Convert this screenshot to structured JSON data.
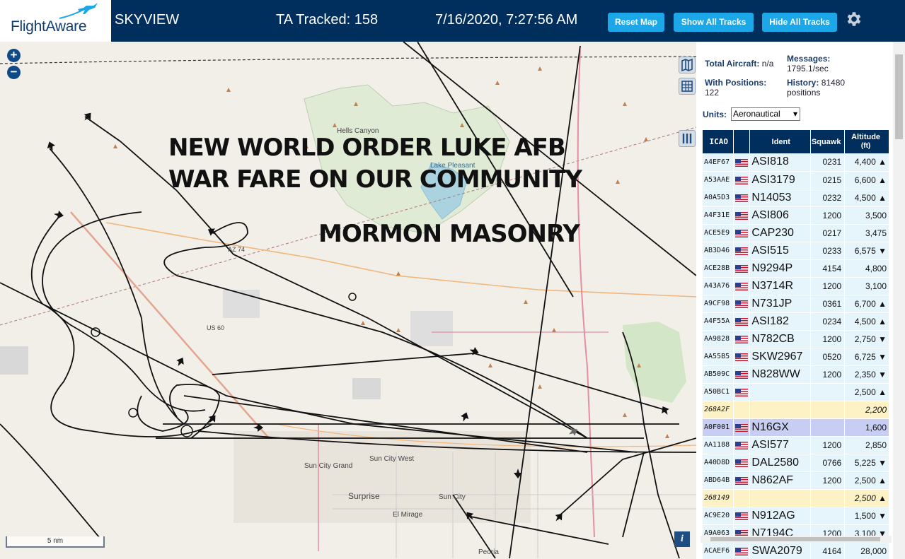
{
  "header": {
    "logo": "FlightAware",
    "app_name": "SKYVIEW",
    "tracked": "TA Tracked: 158",
    "datetime": "7/16/2020, 7:27:56 AM",
    "reset_map": "Reset Map",
    "show_all": "Show All Tracks",
    "hide_all": "Hide All Tracks",
    "settings_icon": "gear-icon"
  },
  "map": {
    "zoom_in": "+",
    "zoom_out": "−",
    "scale": "5 nm",
    "info": "i",
    "overlay": {
      "line1": "NEW WORLD ORDER LUKE AFB",
      "line2": "WAR FARE ON OUR COMMUNITY",
      "line3": "MORMON MASONRY"
    },
    "labels": {
      "hells_canyon": "Hells Canyon",
      "lake_pleasant": "Lake Pleasant",
      "az74": "AZ 74",
      "us60": "US 60",
      "sun_city_grand": "Sun City Grand",
      "sun_city_west": "Sun City West",
      "sun_city": "Sun City",
      "surprise": "Surprise",
      "el_mirage": "El Mirage",
      "peoria": "Peoria"
    }
  },
  "stats": {
    "total_label": "Total Aircraft:",
    "total_value": "n/a",
    "positions_label": "With Positions:",
    "positions_value": "122",
    "messages_label": "Messages:",
    "messages_value": "1795.1/sec",
    "history_label": "History:",
    "history_value": "81480",
    "history_unit": "positions",
    "units_label": "Units:",
    "units_value": "Aeronautical"
  },
  "table": {
    "headers": {
      "icao": "ICAO",
      "ident": "Ident",
      "squawk": "Squawk",
      "alt": "Altitude",
      "alt_unit": "(ft)"
    },
    "rows": [
      {
        "icao": "A4EF67",
        "ident": "ASI818",
        "squawk": "0231",
        "alt": "4,400 ▲"
      },
      {
        "icao": "A53AAE",
        "ident": "ASI3179",
        "squawk": "0215",
        "alt": "6,600 ▲"
      },
      {
        "icao": "A0A5D3",
        "ident": "N14053",
        "squawk": "0232",
        "alt": "4,500 ▲"
      },
      {
        "icao": "A4F31E",
        "ident": "ASI806",
        "squawk": "1200",
        "alt": "3,500"
      },
      {
        "icao": "ACE5E9",
        "ident": "CAP230",
        "squawk": "0217",
        "alt": "3,475"
      },
      {
        "icao": "AB3D46",
        "ident": "ASI515",
        "squawk": "0233",
        "alt": "6,575 ▼"
      },
      {
        "icao": "ACE28B",
        "ident": "N9294P",
        "squawk": "4154",
        "alt": "4,800"
      },
      {
        "icao": "A43A76",
        "ident": "N3714R",
        "squawk": "1200",
        "alt": "3,100"
      },
      {
        "icao": "A9CF98",
        "ident": "N731JP",
        "squawk": "0361",
        "alt": "6,700 ▲"
      },
      {
        "icao": "A4F55A",
        "ident": "ASI182",
        "squawk": "0234",
        "alt": "4,500 ▲"
      },
      {
        "icao": "AA9828",
        "ident": "N782CB",
        "squawk": "1200",
        "alt": "2,750 ▼"
      },
      {
        "icao": "AA55B5",
        "ident": "SKW2967",
        "squawk": "0520",
        "alt": "6,725 ▼"
      },
      {
        "icao": "AB509C",
        "ident": "N828WW",
        "squawk": "1200",
        "alt": "2,350 ▼"
      },
      {
        "icao": "A50BC1",
        "ident": "",
        "squawk": "",
        "alt": "2,500 ▲"
      },
      {
        "icao": "268A2F",
        "ident": "",
        "squawk": "",
        "alt": "2,200",
        "style": "yellow"
      },
      {
        "icao": "A0F001",
        "ident": "N16GX",
        "squawk": "",
        "alt": "1,600",
        "style": "selected"
      },
      {
        "icao": "AA1188",
        "ident": "ASI577",
        "squawk": "1200",
        "alt": "2,850"
      },
      {
        "icao": "A40D8D",
        "ident": "DAL2580",
        "squawk": "0766",
        "alt": "5,225 ▼"
      },
      {
        "icao": "ABD64B",
        "ident": "N862AF",
        "squawk": "1200",
        "alt": "2,500 ▲"
      },
      {
        "icao": "268149",
        "ident": "",
        "squawk": "",
        "alt": "2,500 ▲",
        "style": "yellow"
      },
      {
        "icao": "AC9E20",
        "ident": "N912AG",
        "squawk": "",
        "alt": "1,500 ▼"
      },
      {
        "icao": "A9A063",
        "ident": "N7194C",
        "squawk": "1200",
        "alt": "3,100 ▼"
      },
      {
        "icao": "ACAEF6",
        "ident": "SWA2079",
        "squawk": "4164",
        "alt": "28,000"
      }
    ]
  }
}
